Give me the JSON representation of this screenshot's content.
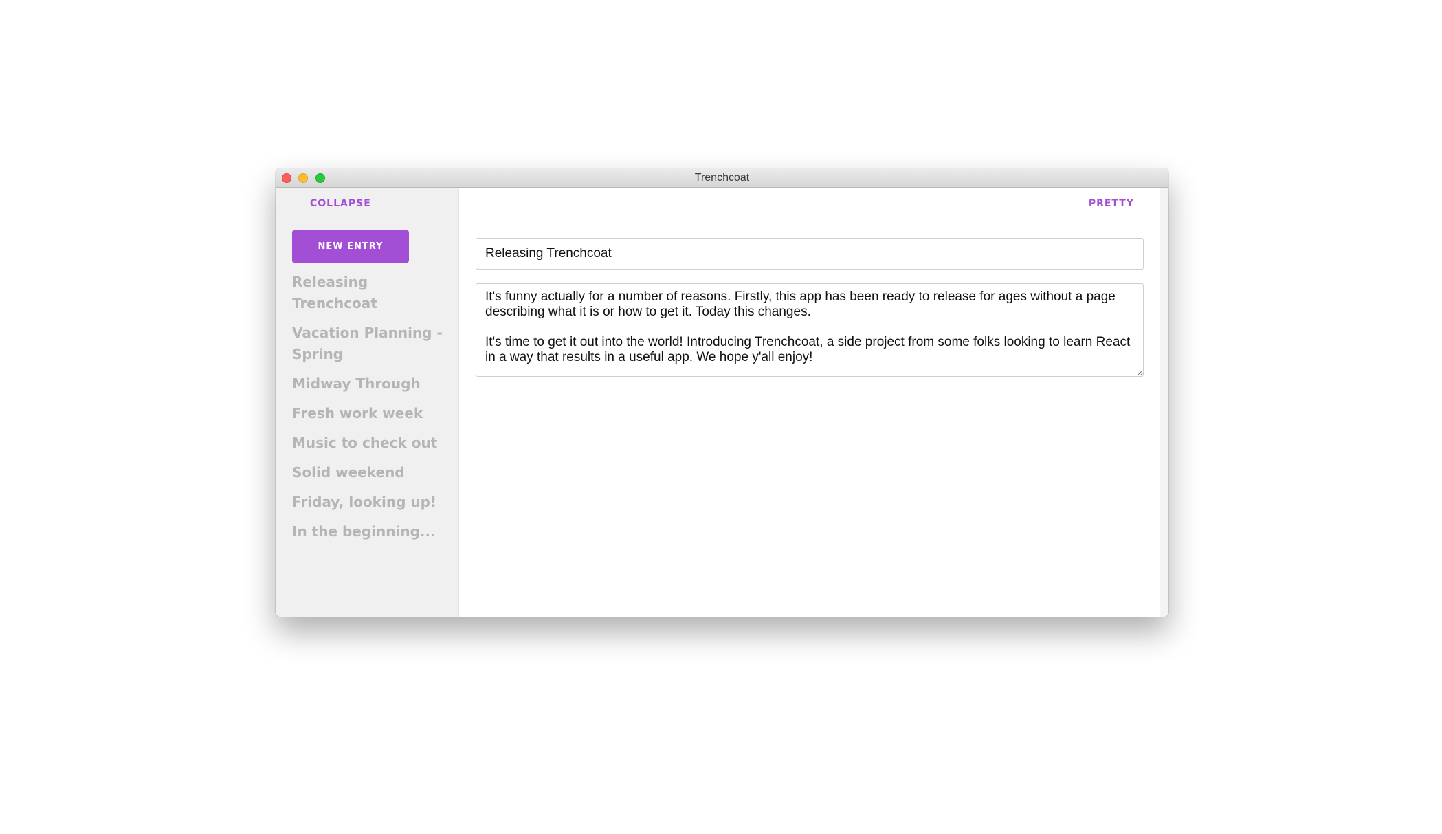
{
  "window": {
    "title": "Trenchcoat"
  },
  "sidebar": {
    "collapse_label": "COLLAPSE",
    "new_entry_label": "NEW ENTRY",
    "entries": [
      "Releasing Trenchcoat",
      "Vacation Planning - Spring",
      "Midway Through",
      "Fresh work week",
      "Music to check out",
      "Solid weekend",
      "Friday, looking up!",
      "In the beginning..."
    ]
  },
  "editor": {
    "pretty_label": "PRETTY",
    "title_value": "Releasing Trenchcoat",
    "body_value": "It's funny actually for a number of reasons. Firstly, this app has been ready to release for ages without a page describing what it is or how to get it. Today this changes.\n\nIt's time to get it out into the world! Introducing Trenchcoat, a side project from some folks looking to learn React in a way that results in a useful app. We hope y'all enjoy!"
  },
  "colors": {
    "accent": "#a24fd6",
    "sidebar_bg": "#f0f0f0",
    "entry_text": "#b5b5b5"
  }
}
